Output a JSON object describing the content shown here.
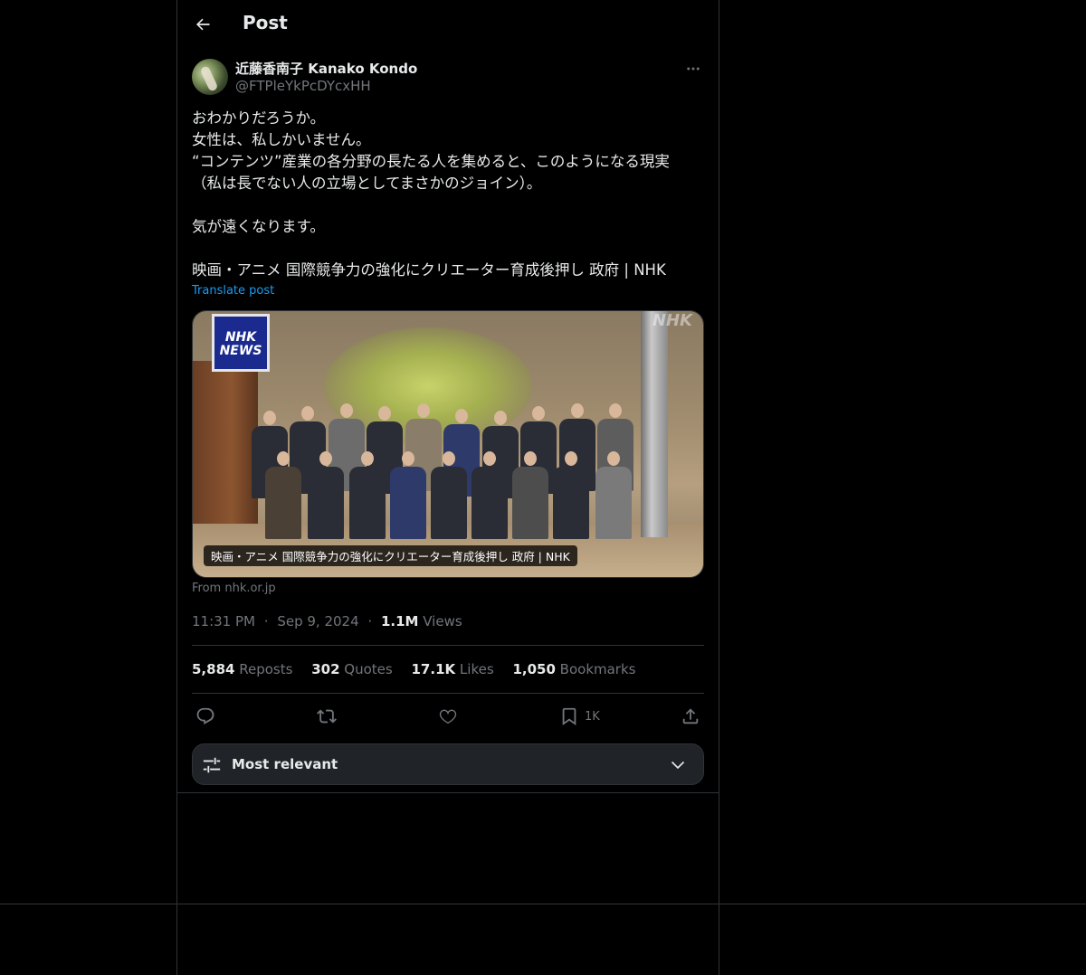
{
  "header": {
    "title": "Post"
  },
  "author": {
    "name": "近藤香南子 Kanako Kondo",
    "handle": "@FTPleYkPcDYcxHH"
  },
  "tweet": {
    "lines": [
      "おわかりだろうか。",
      "女性は、私しかいません。",
      "“コンテンツ”産業の各分野の長たる人を集めると、このようになる現実",
      "（私は長でない人の立場としてまさかのジョイン）。",
      "",
      "気が遠くなります。",
      "",
      "映画・アニメ 国際競争力の強化にクリエーター育成後押し 政府 | NHK"
    ],
    "translate_label": "Translate post"
  },
  "card": {
    "logo_line1": "NHK",
    "logo_line2": "NEWS",
    "watermark": "NHK",
    "caption": "映画・アニメ 国際競争力の強化にクリエーター育成後押し 政府 | NHK",
    "source": "From nhk.or.jp"
  },
  "meta": {
    "time": "11:31 PM",
    "date": "Sep 9, 2024",
    "views_count": "1.1M",
    "views_label": "Views",
    "dot": "·"
  },
  "stats": [
    {
      "count": "5,884",
      "label": "Reposts"
    },
    {
      "count": "302",
      "label": "Quotes"
    },
    {
      "count": "17.1K",
      "label": "Likes"
    },
    {
      "count": "1,050",
      "label": "Bookmarks"
    }
  ],
  "actions": {
    "bookmark_count": "1K",
    "icons": [
      "reply-icon",
      "repost-icon",
      "like-icon",
      "bookmark-icon",
      "share-icon"
    ]
  },
  "sort": {
    "label": "Most relevant"
  },
  "colors": {
    "background": "#000000",
    "border": "#2f3336",
    "accent": "#1d9bf0",
    "muted": "#71767b",
    "text": "#e7e9ea"
  }
}
